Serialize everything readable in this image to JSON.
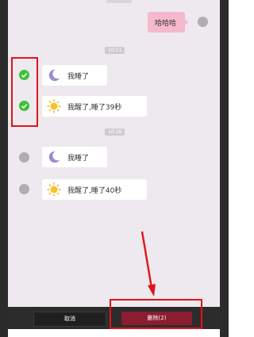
{
  "messages": [
    {
      "text": "我睡了",
      "icon": "moon-icon"
    },
    {
      "text": "我醒了,睡了39秒",
      "icon": "sun-icon"
    },
    {
      "text": "我睡了",
      "icon": "moon-icon"
    },
    {
      "text": "我醒了,睡了40秒",
      "icon": "sun-icon"
    }
  ],
  "sent_message": {
    "text": "哈哈哈"
  },
  "timestamps": [
    "10:11",
    "10:38"
  ],
  "selection": {
    "checked": [
      true,
      true,
      false,
      false
    ]
  },
  "buttons": {
    "cancel_label": "取消",
    "delete_label": "删除(2)"
  },
  "colors": {
    "chat_bg": "#ede9ee",
    "checked": "#3fbf3b",
    "delete_button": "#8b1d31",
    "highlight": "#e0141b",
    "sent_bubble": "#f5b8cd"
  }
}
